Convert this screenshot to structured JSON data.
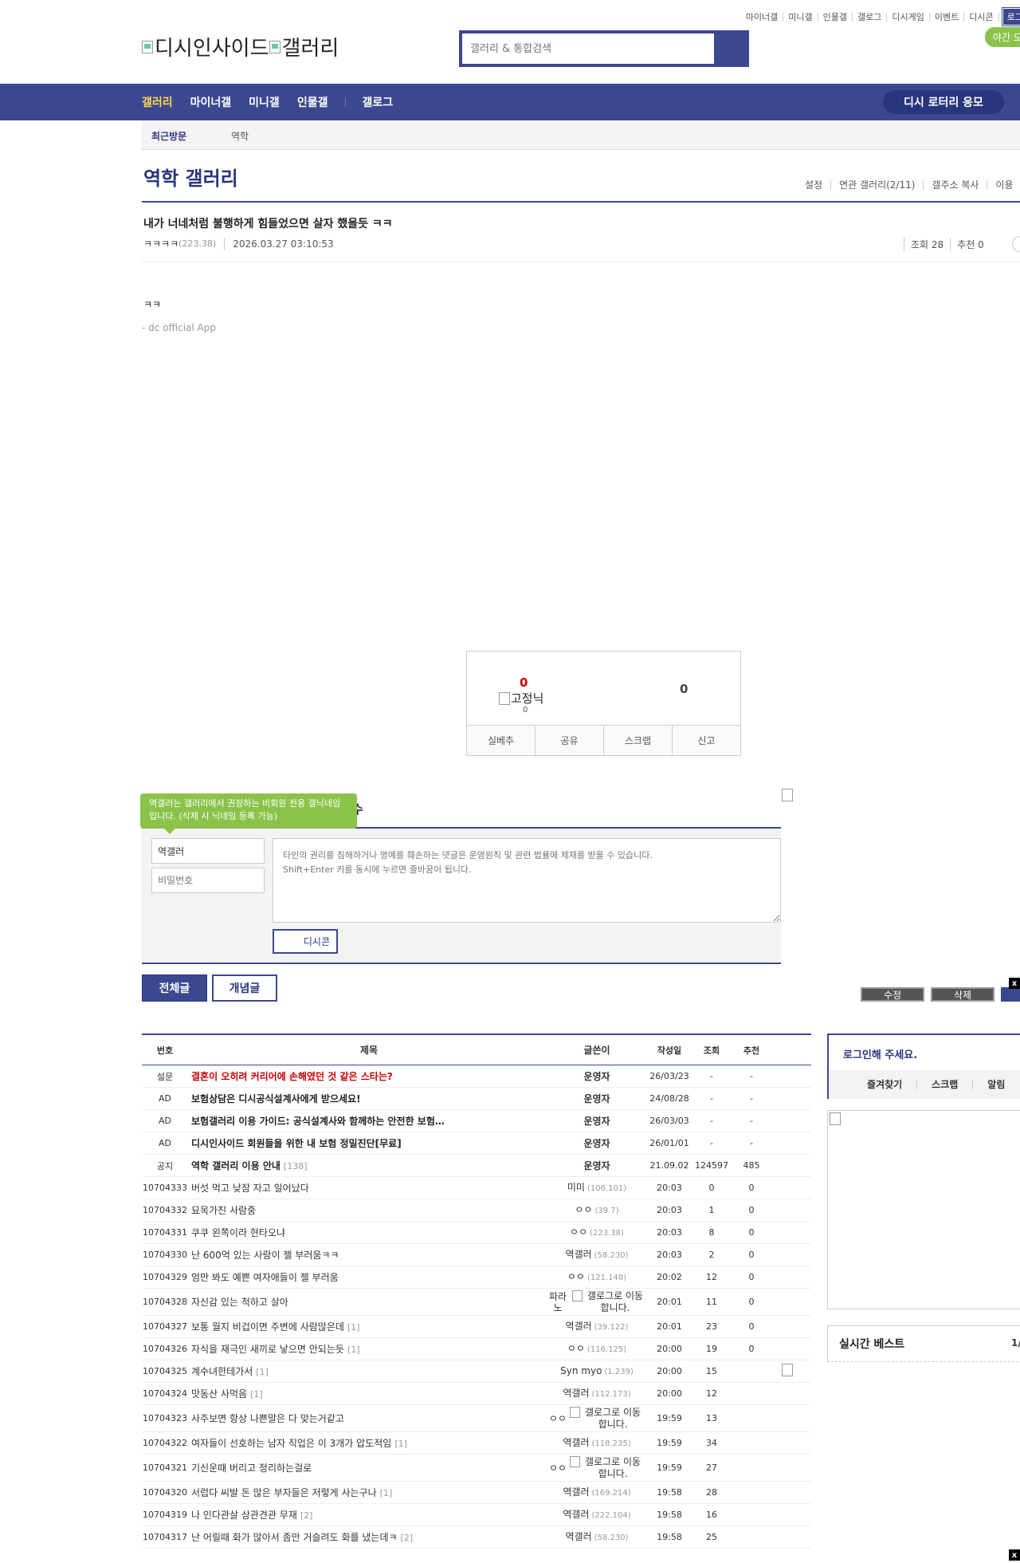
{
  "top_links": [
    "마이너갤",
    "미니갤",
    "인물갤",
    "갤로그",
    "디시게임",
    "이벤트",
    "디시콘"
  ],
  "login_label": "로그인",
  "night_mode": "야간 모",
  "logo_text": "디시인사이드",
  "logo_text2": "갤러리",
  "search_placeholder": "갤러리 & 통합검색",
  "nav": [
    "갤러리",
    "마이너갤",
    "미니갤",
    "인물갤",
    "갤로그"
  ],
  "lottery": "디시 로터리 응모",
  "recent": {
    "title": "최근방문",
    "item": "역학"
  },
  "gallery_title": "역학 갤러리",
  "gallery_menu": [
    "설정",
    "연관 갤러리(2/11)",
    "갤주소 복사",
    "이용"
  ],
  "post": {
    "title": "내가 너네처럼 불행하게 힘들었으면 살자 했을듯 ㅋㅋ",
    "author": "ㅋㅋㅋㅋ",
    "ip": "(223.38)",
    "date": "2026.03.27 03:10:53",
    "views": "조회 28",
    "recommend": "추천 0",
    "body": "ㅋㅋ",
    "app": "- dc official App"
  },
  "recommend_box": {
    "up": "0",
    "fixed_label": "고정닉",
    "fixed_count": "0",
    "down": "0",
    "buttons": [
      "실베추",
      "공유",
      "스크랩",
      "신고"
    ]
  },
  "comment": {
    "tooltip": "역갤러는 갤러리에서 권장하는 비회원 전용 갤닉네임입니다. (삭제 시 닉네임 등록 가능)",
    "header_tail": "수",
    "name_value": "역갤러",
    "pw_placeholder": "비밀번호",
    "text_placeholder": "타인의 권리를 침해하거나 명예를 훼손하는 댓글은 운영원칙 및 관련 법률에 제재를 받을 수 있습니다.\nShift+Enter 키를 동시에 누르면 줄바꿈이 됩니다.",
    "dccon": "디시콘"
  },
  "list_buttons": {
    "all": "전체글",
    "concept": "개념글",
    "btn1": "수정",
    "btn2": "삭제"
  },
  "table": {
    "headers": [
      "번호",
      "제목",
      "글쓴이",
      "작성일",
      "조회",
      "추천"
    ],
    "rows": [
      {
        "no": "설문",
        "title": "결혼이 오히려 커리어에 손해였던 것 같은 스타는?",
        "count": "",
        "writer": "운영자",
        "ip": "",
        "date": "26/03/23",
        "views": "-",
        "rec": "-",
        "kind": "red"
      },
      {
        "no": "AD",
        "title": "보험상담은 디시공식설계사에게 받으세요!",
        "count": "",
        "writer": "운영자",
        "ip": "",
        "date": "24/08/28",
        "views": "-",
        "rec": "-",
        "kind": "notice"
      },
      {
        "no": "AD",
        "title": "보험갤러리 이용 가이드: 공식설계사와 함께하는 안전한 보험…",
        "count": "",
        "writer": "운영자",
        "ip": "",
        "date": "26/03/03",
        "views": "-",
        "rec": "-",
        "kind": "notice"
      },
      {
        "no": "AD",
        "title": "디시인사이드 회원들을 위한 내 보험 정밀진단[무료]",
        "count": "",
        "writer": "운영자",
        "ip": "",
        "date": "26/01/01",
        "views": "-",
        "rec": "-",
        "kind": "notice"
      },
      {
        "no": "공지",
        "title": "역학 갤러리 이용 안내",
        "count": "[138]",
        "writer": "운영자",
        "ip": "",
        "date": "21.09.02",
        "views": "124597",
        "rec": "485",
        "kind": "notice"
      },
      {
        "no": "10704333",
        "title": "버섯 먹고 낮잠 자고 일어났다",
        "count": "",
        "writer": "미미",
        "ip": "(106.101)",
        "date": "20:03",
        "views": "0",
        "rec": "0",
        "kind": "normal"
      },
      {
        "no": "10704332",
        "title": "묘목가진 사람중",
        "count": "",
        "writer": "ㅇㅇ",
        "ip": "(39.7)",
        "date": "20:03",
        "views": "1",
        "rec": "0",
        "kind": "normal"
      },
      {
        "no": "10704331",
        "title": "쿠쿠 왼쪽이라 현타오냐",
        "count": "",
        "writer": "ㅇㅇ",
        "ip": "(223.38)",
        "date": "20:03",
        "views": "8",
        "rec": "0",
        "kind": "normal"
      },
      {
        "no": "10704330",
        "title": "난 600억 있는 사람이 젤 부러움ㅋㅋ",
        "count": "",
        "writer": "역갤러",
        "ip": "(58.230)",
        "date": "20:03",
        "views": "2",
        "rec": "0",
        "kind": "normal"
      },
      {
        "no": "10704329",
        "title": "엄만 봐도 예쁜 여자애들이 젤 부러움",
        "count": "",
        "writer": "ㅇㅇ",
        "ip": "(121.148)",
        "date": "20:02",
        "views": "12",
        "rec": "0",
        "kind": "normal"
      },
      {
        "no": "10704328",
        "title": "자신감 있는 척하고 살아",
        "count": "",
        "writer": "파라노",
        "ip": "",
        "date": "20:01",
        "views": "11",
        "rec": "0",
        "kind": "gallog"
      },
      {
        "no": "10704327",
        "title": "보통 월지 비겁이면 주변에 사람많은데",
        "count": "[1]",
        "writer": "역갤러",
        "ip": "(39.122)",
        "date": "20:01",
        "views": "23",
        "rec": "0",
        "kind": "normal"
      },
      {
        "no": "10704326",
        "title": "자식을 재극인 새끼로 낳으면 안되는듯",
        "count": "[1]",
        "writer": "ㅇㅇ",
        "ip": "(116.125)",
        "date": "20:00",
        "views": "19",
        "rec": "0",
        "kind": "normal"
      },
      {
        "no": "10704325",
        "title": "계수녀한테가서",
        "count": "[1]",
        "writer": "Syn myo",
        "ip": "(1.239)",
        "date": "20:00",
        "views": "15",
        "rec": "",
        "kind": "normal"
      },
      {
        "no": "10704324",
        "title": "맛동산 사먹음",
        "count": "[1]",
        "writer": "역갤러",
        "ip": "(112.173)",
        "date": "20:00",
        "views": "12",
        "rec": "",
        "kind": "normal"
      },
      {
        "no": "10704323",
        "title": "사주보면 항상 나쁜말은 다 맞는거같고",
        "count": "",
        "writer": "ㅇㅇ",
        "ip": "",
        "date": "19:59",
        "views": "13",
        "rec": "",
        "kind": "gallog"
      },
      {
        "no": "10704322",
        "title": "여자들이 선호하는 남자 직업은 이 3개가 압도적임",
        "count": "[1]",
        "writer": "역갤러",
        "ip": "(118.235)",
        "date": "19:59",
        "views": "34",
        "rec": "",
        "kind": "normal"
      },
      {
        "no": "10704321",
        "title": "기신운때 버리고 정리하는걸로",
        "count": "",
        "writer": "ㅇㅇ",
        "ip": "",
        "date": "19:59",
        "views": "27",
        "rec": "",
        "kind": "gallog"
      },
      {
        "no": "10704320",
        "title": "서럽다 씨발 돈 많은 부자들은 저렇게 사는구나",
        "count": "[1]",
        "writer": "역갤러",
        "ip": "(169.214)",
        "date": "19:58",
        "views": "28",
        "rec": "",
        "kind": "normal"
      },
      {
        "no": "10704319",
        "title": "나 인다관살 상관견관 무재",
        "count": "[2]",
        "writer": "역갤러",
        "ip": "(222.104)",
        "date": "19:58",
        "views": "16",
        "rec": "",
        "kind": "normal"
      },
      {
        "no": "10704317",
        "title": "난 어릴때 화가 많아서 좀만 거슬려도 화를 냈는데ㅋ",
        "count": "[2]",
        "writer": "역갤러",
        "ip": "(58.230)",
        "date": "19:58",
        "views": "25",
        "rec": "",
        "kind": "normal"
      }
    ],
    "gallog_label": "갤로그로 이동합니다."
  },
  "right": {
    "login_prompt": "로그인해 주세요.",
    "login_links": [
      "즐겨찾기",
      "스크랩",
      "알림"
    ],
    "best_title": "실시간 베스트",
    "best_page": "1/"
  }
}
